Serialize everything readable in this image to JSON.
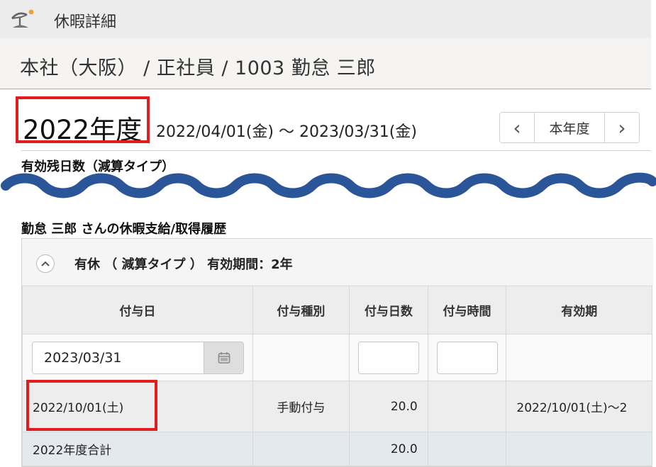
{
  "app": {
    "title": "休暇詳細"
  },
  "breadcrumb": {
    "text": "本社（大阪） / 正社員 / 1003 勤怠 三郎"
  },
  "fiscal": {
    "year_title": "2022年度",
    "period": "2022/04/01(金) ～ 2023/03/31(金)",
    "nav_current": "本年度",
    "nav_prev_glyph": "‹",
    "nav_next_glyph": "›"
  },
  "sections": {
    "remaining_label": "有効残日数（減算タイプ）",
    "history_label": "勤怠 三郎 さんの休暇支給/取得履歴"
  },
  "panel": {
    "title": "有休 （ 減算タイプ ） 有効期間：2年",
    "collapse_glyph": "⌃"
  },
  "table": {
    "headers": [
      "付与日",
      "付与種別",
      "付与日数",
      "付与時間",
      "有効期"
    ],
    "filter": {
      "date_value": "2023/03/31",
      "days_value": "",
      "hours_value": ""
    },
    "rows": [
      {
        "date": "2022/10/01(土)",
        "type": "手動付与",
        "days": "20.0",
        "hours": "",
        "validity": "2022/10/01(土)～2"
      }
    ],
    "total": {
      "label": "2022年度合計",
      "days": "20.0"
    }
  },
  "colors": {
    "accent_red": "#e21c1c",
    "wave_blue": "#2a5599",
    "header_gray": "#ededed",
    "total_row": "#e4e8ef"
  },
  "icons": {
    "app": "beach-umbrella-icon",
    "calendar": "calendar-icon",
    "collapse": "chevron-up-icon"
  }
}
